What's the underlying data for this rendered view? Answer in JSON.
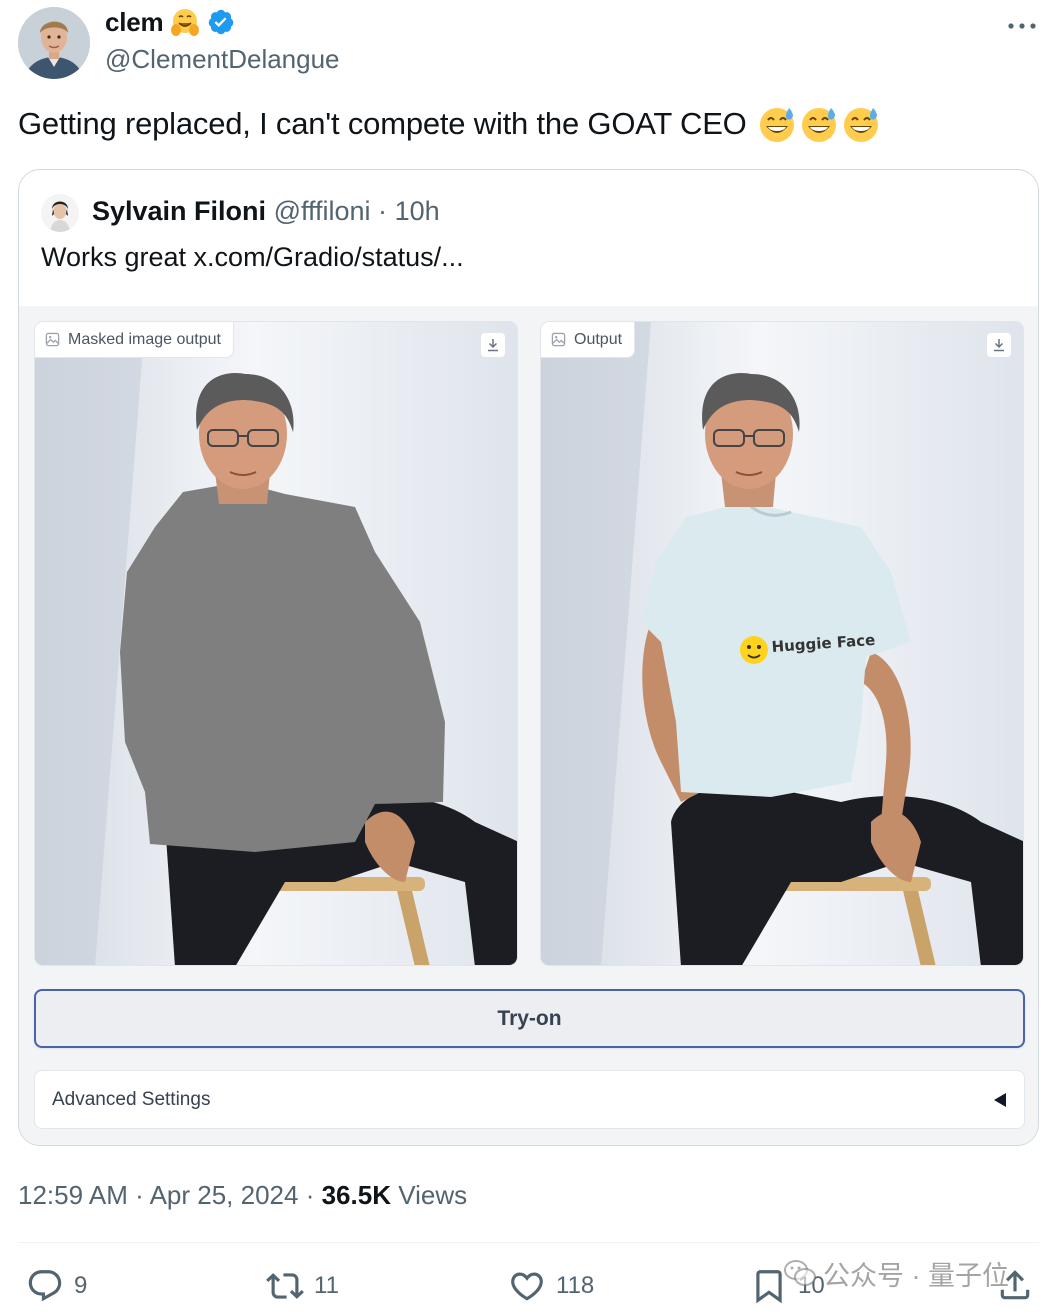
{
  "author": {
    "display_name": "clem",
    "handle": "@ClementDelangue",
    "emoji_icon": "hugging-face-emoji",
    "verified_icon": "verified-badge-icon"
  },
  "tweet": {
    "text": "Getting replaced, I can't compete with the GOAT CEO",
    "emojis": [
      "grinning-sweat-emoji",
      "grinning-sweat-emoji",
      "grinning-sweat-emoji"
    ]
  },
  "quote": {
    "display_name": "Sylvain Filoni",
    "handle": "@fffiloni",
    "separator": "·",
    "age": "10h",
    "text": "Works great  x.com/Gradio/status/..."
  },
  "gradio": {
    "left_panel_label": "Masked image output",
    "right_panel_label": "Output",
    "shirt_logo_text": "Huggie Face",
    "tryon_label": "Try-on",
    "advanced_label": "Advanced Settings"
  },
  "meta": {
    "time": "12:59 AM",
    "date": "Apr 25, 2024",
    "separator": "·",
    "views_count": "36.5K",
    "views_label": "Views"
  },
  "actions": {
    "replies": "9",
    "reposts": "11",
    "likes": "118",
    "bookmarks": "10"
  },
  "watermark": {
    "text": "公众号 · 量子位"
  },
  "colors": {
    "text": "#0f1419",
    "secondary": "#536471",
    "verified": "#1d9bf0",
    "tryon_border": "#4763a9",
    "mask_gray": "#7f7f7f"
  }
}
